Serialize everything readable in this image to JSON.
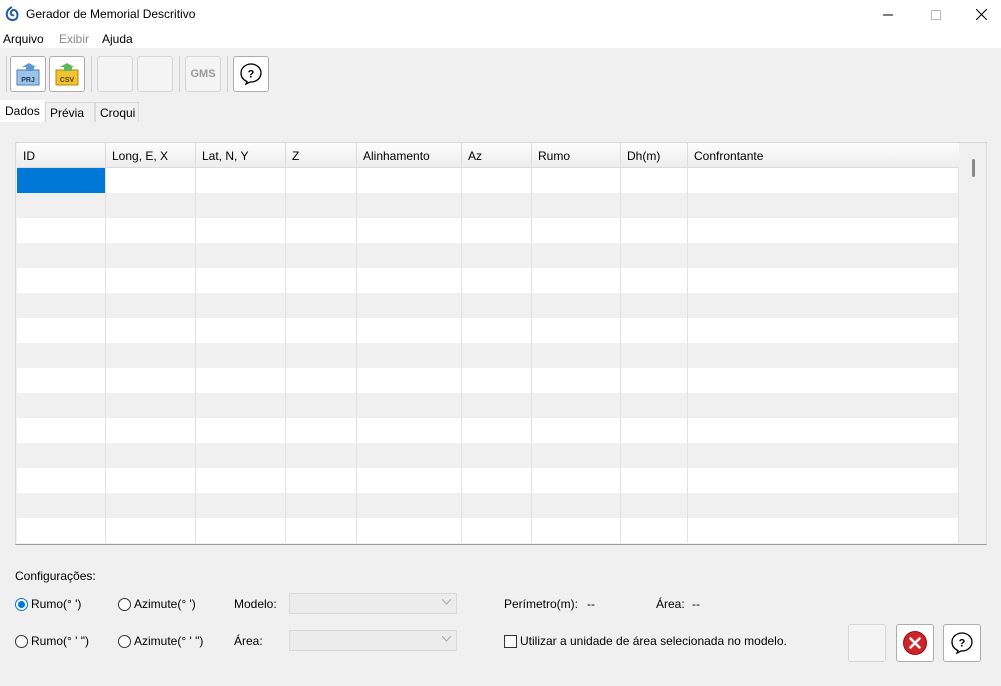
{
  "window": {
    "title": "Gerador de Memorial Descritivo",
    "controls": [
      "minimize",
      "maximize",
      "close"
    ]
  },
  "menu": {
    "items": [
      {
        "label": "Arquivo",
        "enabled": true
      },
      {
        "label": "Exibir",
        "enabled": false
      },
      {
        "label": "Ajuda",
        "enabled": true
      }
    ]
  },
  "toolbar": {
    "prj_label": "PRJ",
    "csv_label": "CSV",
    "gms_label": "GMS",
    "help_icon": "help-bubble-icon"
  },
  "tabs": [
    {
      "label": "Dados",
      "selected": true
    },
    {
      "label": "Prévia",
      "selected": false
    },
    {
      "label": "Croqui",
      "selected": false
    }
  ],
  "grid": {
    "columns": [
      "ID",
      "Long, E, X",
      "Lat, N, Y",
      "Z",
      "Alinhamento",
      "Az",
      "Rumo",
      "Dh(m)",
      "Confrontante"
    ],
    "row_count": 15,
    "selected_cell": {
      "row": 0,
      "col": 0
    }
  },
  "config": {
    "title": "Configurações:",
    "radio_rumo_dm": "Rumo(° ')",
    "radio_azimute_dm": "Azimute(° ')",
    "radio_rumo_dms": "Rumo(° ' \")",
    "radio_azimute_dms": "Azimute(° ' \")",
    "selected_radio": "radio_rumo_dm",
    "modelo_label": "Modelo:",
    "modelo_value": "",
    "area_label": "Área:",
    "area_value": "",
    "perimetro_label": "Perímetro(m):",
    "perimetro_value": "--",
    "area_result_label": "Área:",
    "area_result_value": "--",
    "use_unit_label": "Utilizar a unidade de área selecionada no modelo.",
    "use_unit_checked": false
  },
  "colors": {
    "accent": "#0078d7",
    "close_red": "#d1232a",
    "csv_yellow": "#f2c230"
  }
}
